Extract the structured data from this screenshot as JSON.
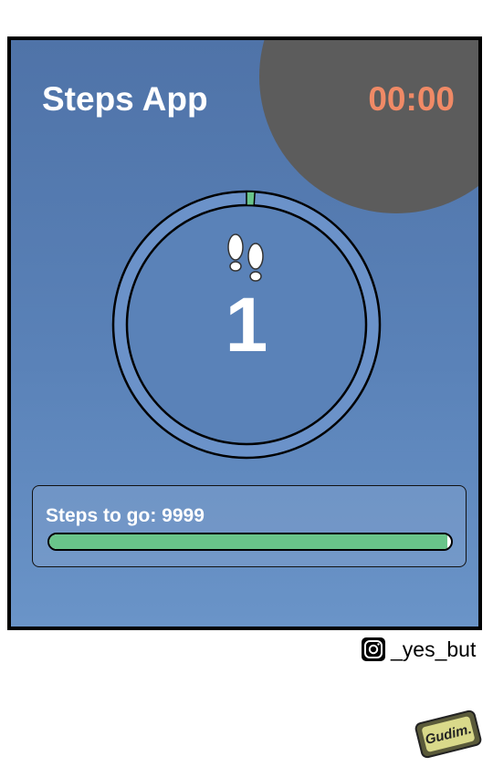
{
  "app": {
    "title": "Steps App",
    "timer": "00:00",
    "step_count": "1",
    "ring_progress": 0.01,
    "goal_label": "Steps to go: 9999",
    "goal_progress": 0.99
  },
  "credit": {
    "handle": "_yes_but",
    "signature": "Gudim."
  },
  "colors": {
    "panel_blue": "#5a82b8",
    "timer_orange": "#f08a66",
    "progress_green": "#69c48a",
    "corner_gray": "#5c5c5c"
  },
  "icons": [
    "footprints-icon",
    "instagram-icon"
  ]
}
